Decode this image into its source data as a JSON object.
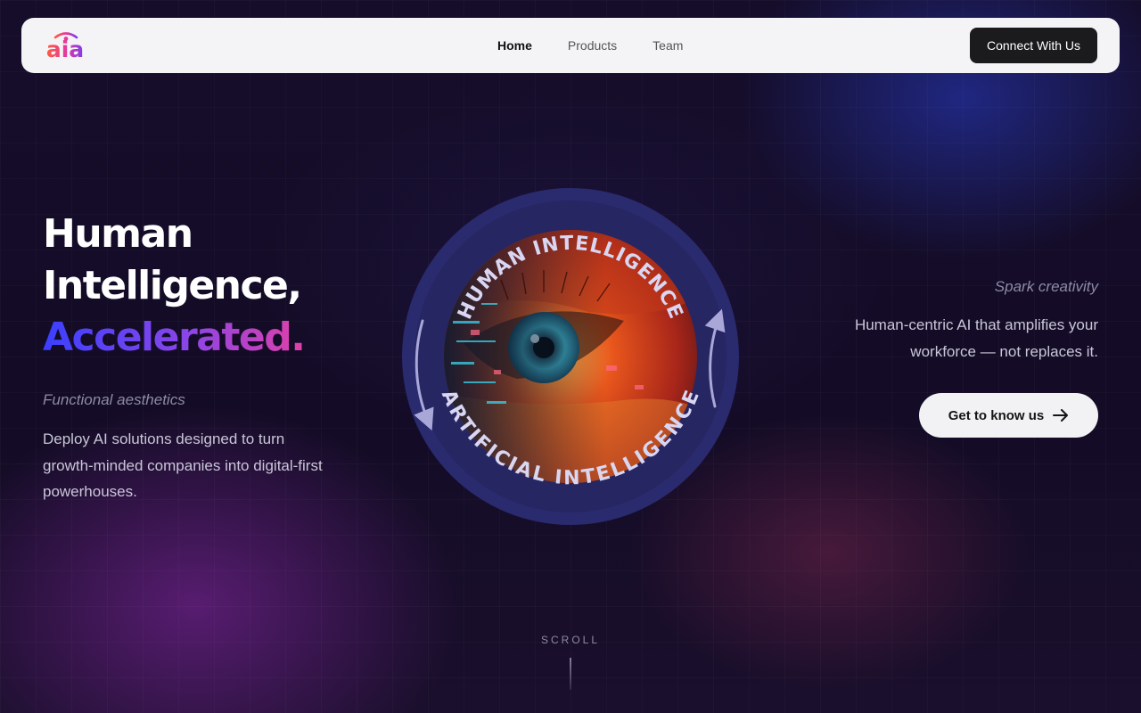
{
  "nav": {
    "logo_text": "aia",
    "items": [
      {
        "label": "Home",
        "active": true
      },
      {
        "label": "Products",
        "active": false
      },
      {
        "label": "Team",
        "active": false
      }
    ],
    "cta": "Connect With Us"
  },
  "hero": {
    "title_line1": "Human",
    "title_line2": "Intelligence,",
    "title_line3": "Accelerated.",
    "left_tagline": "Functional aesthetics",
    "left_body": "Deploy AI solutions designed to turn growth-minded companies into digital-first powerhouses.",
    "right_tagline": "Spark creativity",
    "right_body": "Human-centric AI that amplifies your workforce — not replaces it.",
    "right_cta": "Get to know us"
  },
  "badge": {
    "top_text": "HUMAN INTELLIGENCE",
    "bottom_text": "ARTIFICIAL INTELLIGENCE"
  },
  "scroll": {
    "label": "SCROLL"
  },
  "colors": {
    "gradient_start": "#3a40ff",
    "gradient_end": "#e040a8",
    "nav_bg": "#f4f4f7",
    "cta_dark": "#1b1b1d"
  },
  "icons": {
    "right_cta_icon": "arrow-right-icon"
  }
}
